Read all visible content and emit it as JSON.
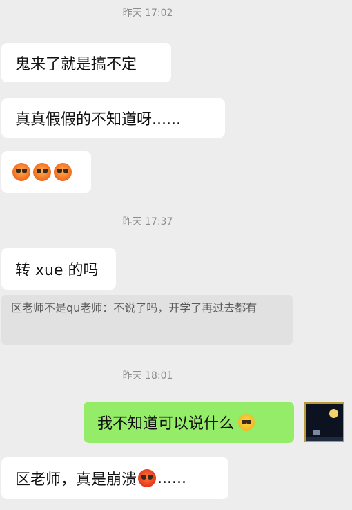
{
  "timestamps": {
    "t1": "昨天 17:02",
    "t2": "昨天 17:37",
    "t3": "昨天 18:01"
  },
  "messages": {
    "m1": "鬼来了就是搞不定",
    "m2": "真真假假的不知道呀......",
    "m3_emojis": [
      "sad-face-icon",
      "sad-face-icon",
      "sad-face-icon"
    ],
    "m4": "转 xue 的吗",
    "quote": "区老师不是qu老师：不说了吗，开学了再过去都有",
    "m5": "我不知道可以说什么",
    "m5_emoji": "crying-laughing-face-icon",
    "m6_text": "区老师，真是崩溃",
    "m6_emoji": "angry-face-icon",
    "m6_tail": "......"
  },
  "colors": {
    "background": "#ededed",
    "incoming_bubble": "#ffffff",
    "outgoing_bubble": "#95ec69"
  }
}
